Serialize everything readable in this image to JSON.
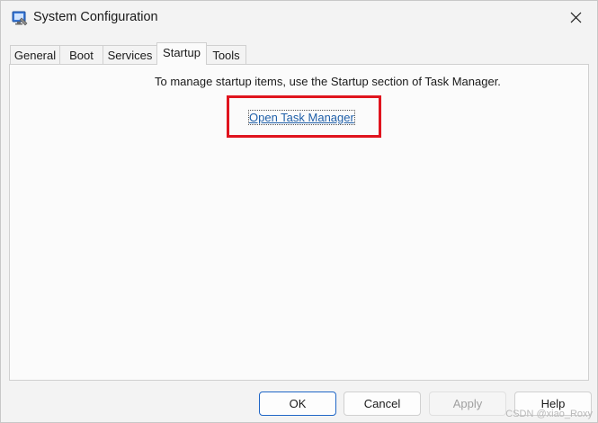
{
  "window": {
    "title": "System Configuration",
    "icon": "msconfig-icon",
    "close_icon": "close-icon"
  },
  "tabs": [
    {
      "label": "General",
      "active": false
    },
    {
      "label": "Boot",
      "active": false
    },
    {
      "label": "Services",
      "active": false
    },
    {
      "label": "Startup",
      "active": true
    },
    {
      "label": "Tools",
      "active": false
    }
  ],
  "startup": {
    "instruction": "To manage startup items, use the Startup section of Task Manager.",
    "link_label": "Open Task Manager"
  },
  "buttons": {
    "ok": "OK",
    "cancel": "Cancel",
    "apply": "Apply",
    "help": "Help"
  },
  "annotation": {
    "highlight_color": "#e0141e"
  },
  "watermark": "CSDN @xiao_Roxy"
}
